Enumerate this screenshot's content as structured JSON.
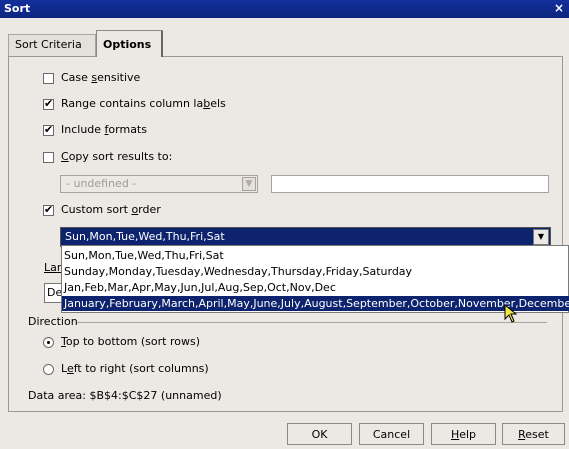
{
  "window": {
    "title": "Sort",
    "close_glyph": "×"
  },
  "tabs": [
    {
      "label": "Sort Criteria"
    },
    {
      "label": "Options"
    }
  ],
  "options": {
    "case_sensitive": {
      "label_pre": "Case ",
      "label_u": "s",
      "label_post": "ensitive",
      "checked": false
    },
    "contains_labels": {
      "label_pre": "Range contains column la",
      "label_u": "b",
      "label_post": "els",
      "checked": true
    },
    "include_formats": {
      "label_pre": "Include ",
      "label_u": "f",
      "label_post": "ormats",
      "checked": true
    },
    "copy_results": {
      "label_pre": "",
      "label_u": "C",
      "label_post": "opy sort results to:",
      "checked": false
    },
    "copy_target_combo": {
      "value": "- undefined -"
    },
    "copy_target_input": {
      "value": ""
    },
    "custom_order": {
      "label_pre": "Custom sort ",
      "label_u": "o",
      "label_post": "rder",
      "checked": true
    },
    "custom_order_combo": {
      "value": "Sun,Mon,Tue,Wed,Thu,Fri,Sat"
    },
    "custom_order_list": [
      "Sun,Mon,Tue,Wed,Thu,Fri,Sat",
      "Sunday,Monday,Tuesday,Wednesday,Thursday,Friday,Saturday",
      "Jan,Feb,Mar,Apr,May,Jun,Jul,Aug,Sep,Oct,Nov,Dec",
      "January,February,March,April,May,June,July,August,September,October,November,December"
    ],
    "partial_language_label": "Lar",
    "partial_language_value": "De",
    "direction": {
      "legend": "Direction",
      "top_to_bottom": {
        "label_u": "T",
        "label_post": "op to bottom (sort rows)",
        "selected": true
      },
      "left_to_right": {
        "label_pre": "L",
        "label_u": "e",
        "label_post": "ft to right (sort columns)",
        "selected": false
      }
    },
    "data_area": "Data area: $B$4:$C$27 (unnamed)"
  },
  "buttons": {
    "ok": "OK",
    "cancel": "Cancel",
    "help_u": "H",
    "help_post": "elp",
    "reset_u": "R",
    "reset_post": "eset"
  }
}
